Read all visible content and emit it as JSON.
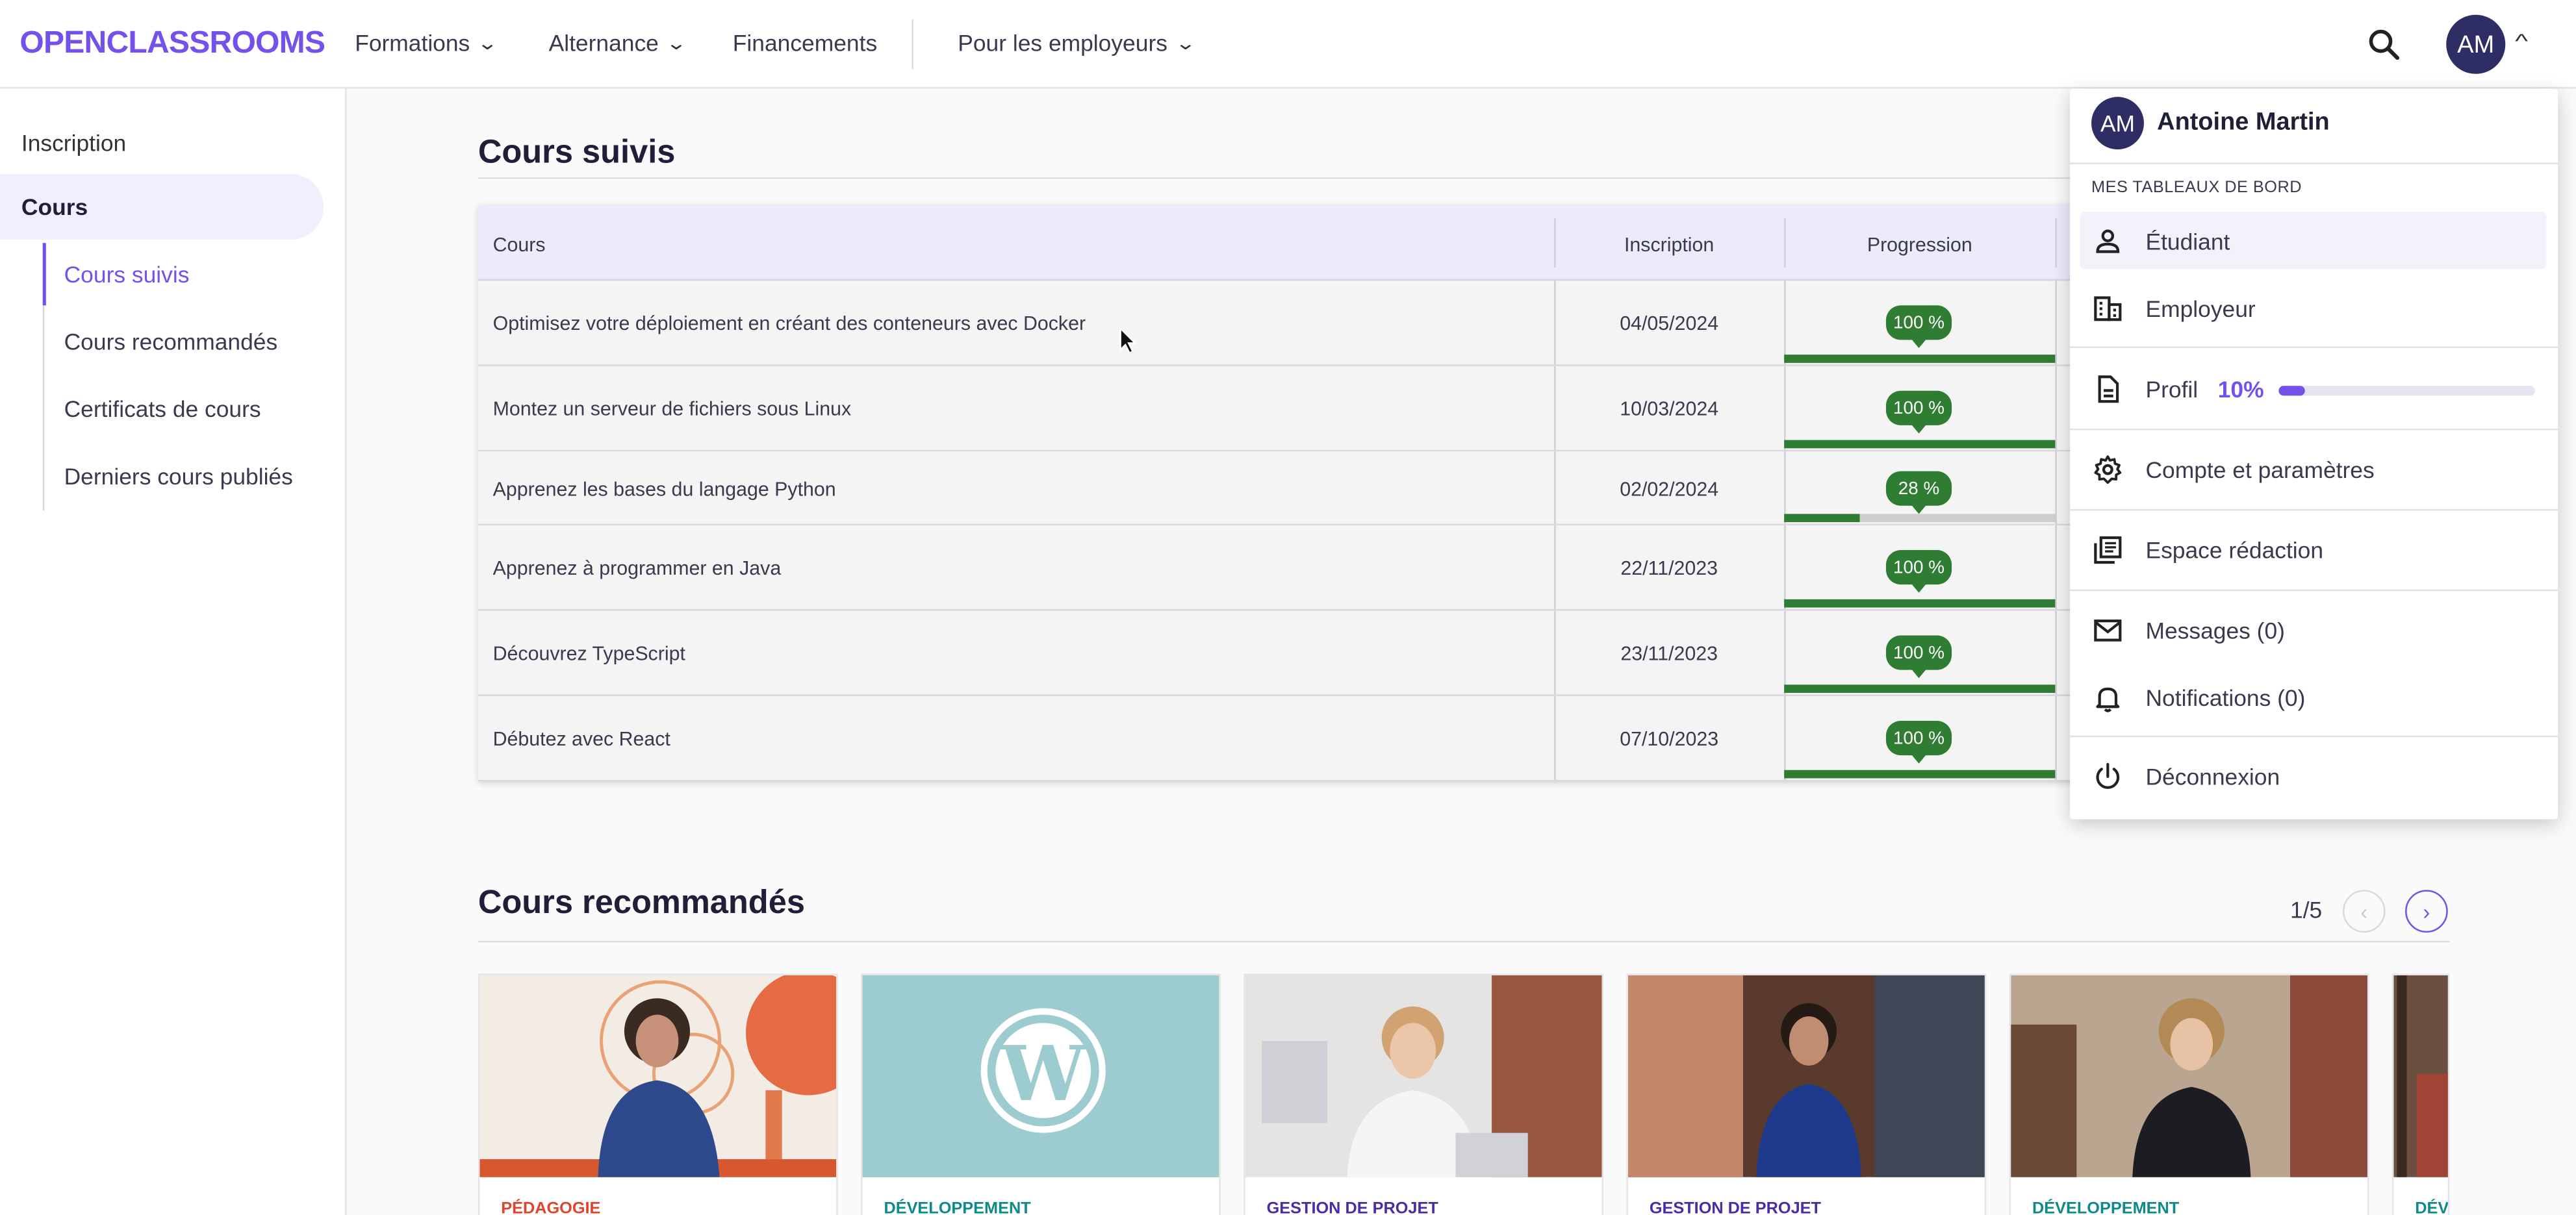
{
  "brand": {
    "logo": "OPENCLASSROOMS",
    "accent": "#7451eb"
  },
  "nav": {
    "items": [
      {
        "label": "Formations"
      },
      {
        "label": "Alternance"
      },
      {
        "label": "Financements"
      },
      {
        "label": "Pour les employeurs"
      }
    ],
    "search_icon": "search-icon",
    "avatar_initials": "AM"
  },
  "sidebar": {
    "inscription": "Inscription",
    "cours": "Cours",
    "sub": [
      {
        "label": "Cours suivis"
      },
      {
        "label": "Cours recommandés"
      },
      {
        "label": "Certificats de cours"
      },
      {
        "label": "Derniers cours publiés"
      }
    ]
  },
  "suivis": {
    "title": "Cours suivis",
    "headers": [
      "Cours",
      "Inscription",
      "Progression"
    ],
    "rows": [
      {
        "title": "Optimisez votre déploiement en créant des conteneurs avec Docker",
        "date": "04/05/2024",
        "progress": "100 %",
        "progress_value": 100
      },
      {
        "title": "Montez un serveur de fichiers sous Linux",
        "date": "10/03/2024",
        "progress": "100 %",
        "progress_value": 100
      },
      {
        "title": "Apprenez les bases du langage Python",
        "date": "02/02/2024",
        "progress": "28 %",
        "progress_value": 28
      },
      {
        "title": "Apprenez à programmer en Java",
        "date": "22/11/2023",
        "progress": "100 %",
        "progress_value": 100
      },
      {
        "title": "Découvrez TypeScript",
        "date": "23/11/2023",
        "progress": "100 %",
        "progress_value": 100
      },
      {
        "title": "Débutez avec React",
        "date": "07/10/2023",
        "progress": "100 %",
        "progress_value": 100
      }
    ],
    "progress_color": "#2e7d32"
  },
  "recommandes": {
    "title": "Cours recommandés",
    "pager": "1/5",
    "cards": [
      {
        "category": "PÉDAGOGIE",
        "color": "#e0452b"
      },
      {
        "category": "DÉVELOPPEMENT",
        "color": "#0e8a8a"
      },
      {
        "category": "GESTION DE PROJET",
        "color": "#4b2ca6"
      },
      {
        "category": "GESTION DE PROJET",
        "color": "#4b2ca6"
      },
      {
        "category": "DÉVELOPPEMENT",
        "color": "#0e8a8a"
      },
      {
        "category": "DÉV",
        "color": "#0e8a8a"
      }
    ]
  },
  "dropdown": {
    "avatar_initials": "AM",
    "name": "Antoine Martin",
    "section": "MES TABLEAUX DE BORD",
    "etudiant": "Étudiant",
    "employeur": "Employeur",
    "profil": "Profil",
    "profil_pct": "10%",
    "profil_value": 10,
    "compte": "Compte et paramètres",
    "redaction": "Espace rédaction",
    "messages": "Messages (0)",
    "notifications": "Notifications (0)",
    "deconnexion": "Déconnexion"
  }
}
